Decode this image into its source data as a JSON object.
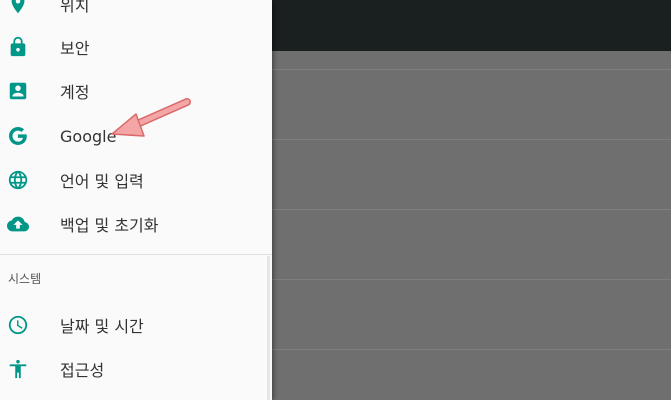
{
  "drawer": {
    "items": [
      {
        "label": "위치",
        "icon": "location-pin-icon"
      },
      {
        "label": "보안",
        "icon": "lock-icon"
      },
      {
        "label": "계정",
        "icon": "account-box-icon"
      },
      {
        "label": "Google",
        "icon": "google-g-icon"
      },
      {
        "label": "언어 및 입력",
        "icon": "globe-icon"
      },
      {
        "label": "백업 및 초기화",
        "icon": "cloud-upload-icon"
      }
    ],
    "system_section": {
      "header": "시스템",
      "items": [
        {
          "label": "날짜 및 시간",
          "icon": "clock-icon"
        },
        {
          "label": "접근성",
          "icon": "accessibility-icon"
        }
      ]
    }
  },
  "colors": {
    "accent": "#009688",
    "scrim": "#6f6f6f",
    "toolbar": "#1a1f20",
    "annotation_arrow": "#f4a0a0"
  }
}
